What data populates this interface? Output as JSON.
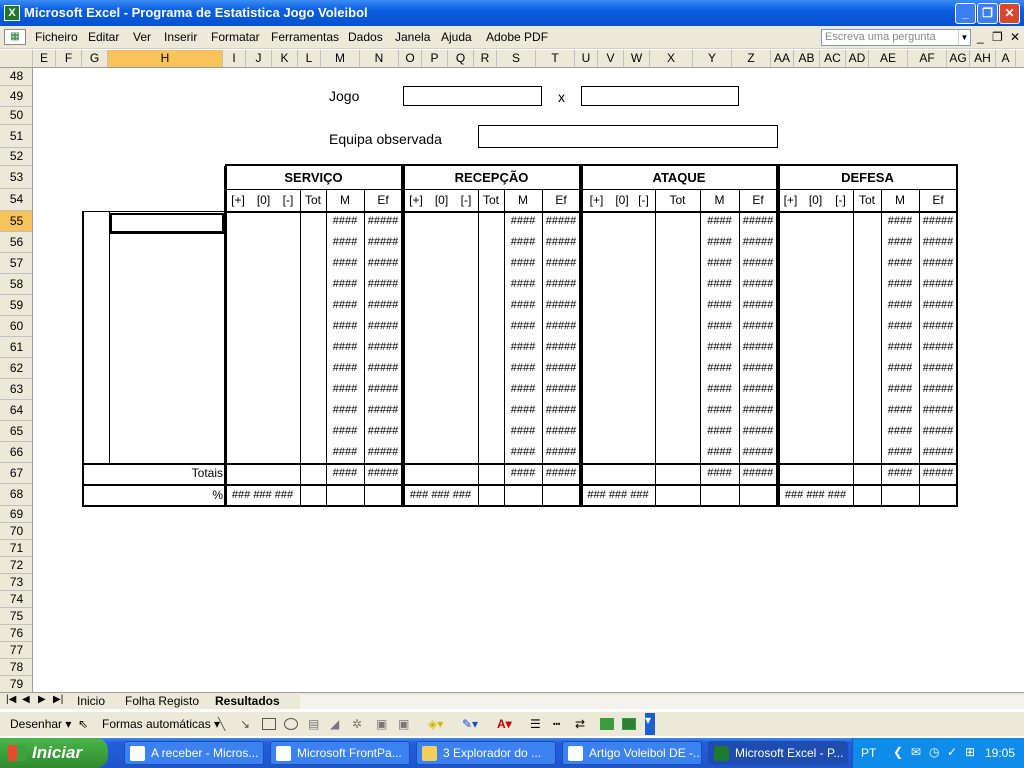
{
  "window": {
    "title": "Microsoft Excel - Programa de Estatistica Jogo Voleibol",
    "app_icon": "X"
  },
  "menu": [
    "Ficheiro",
    "Editar",
    "Ver",
    "Inserir",
    "Formatar",
    "Ferramentas",
    "Dados",
    "Janela",
    "Ajuda",
    "Adobe PDF"
  ],
  "ask_placeholder": "Escreva uma pergunta",
  "columns": [
    "E",
    "F",
    "G",
    "H",
    "I",
    "J",
    "K",
    "L",
    "M",
    "N",
    "O",
    "P",
    "Q",
    "R",
    "S",
    "T",
    "U",
    "V",
    "W",
    "X",
    "Y",
    "Z",
    "AA",
    "AB",
    "AC",
    "AD",
    "AE",
    "AF",
    "AG",
    "AH",
    "A"
  ],
  "selected_column": "H",
  "rows": [
    "48",
    "49",
    "50",
    "51",
    "52",
    "53",
    "54",
    "55",
    "56",
    "57",
    "58",
    "59",
    "60",
    "61",
    "62",
    "63",
    "64",
    "65",
    "66",
    "67",
    "68",
    "69",
    "70",
    "71",
    "72",
    "73",
    "74",
    "75",
    "76",
    "77",
    "78",
    "79"
  ],
  "selected_row": "55",
  "sheet": {
    "jogo_label": "Jogo",
    "x_label": "x",
    "equipa_label": "Equipa observada",
    "sections": [
      {
        "title": "SERVIÇO",
        "headers": [
          "[+]",
          "[0]",
          "[-]",
          "Tot",
          "M",
          "Ef"
        ]
      },
      {
        "title": "RECEPÇÃO",
        "headers": [
          "[+]",
          "[0]",
          "[-]",
          "Tot",
          "M",
          "Ef"
        ]
      },
      {
        "title": "ATAQUE",
        "headers": [
          "[+]",
          "[0]",
          "[-]",
          "Tot",
          "M",
          "Ef"
        ]
      },
      {
        "title": "DEFESA",
        "headers": [
          "[+]",
          "[0]",
          "[-]",
          "Tot",
          "M",
          "Ef"
        ]
      }
    ],
    "m_value": "####",
    "ef_value": "#####",
    "totais_label": "Totais",
    "percent_label": "%",
    "percent_value": "### ### ###"
  },
  "tabs": [
    "Inicio",
    "Folha Registo",
    "Resultados"
  ],
  "active_tab": "Resultados",
  "drawing": {
    "desenhar": "Desenhar",
    "formas": "Formas automáticas"
  },
  "taskbar": {
    "start": "Iniciar",
    "items": [
      "A receber - Micros...",
      "Microsoft FrontPa...",
      "3 Explorador do ...",
      "Artigo Voleibol DE -...",
      "Microsoft Excel - P..."
    ],
    "lang": "PT",
    "time": "19:05"
  }
}
